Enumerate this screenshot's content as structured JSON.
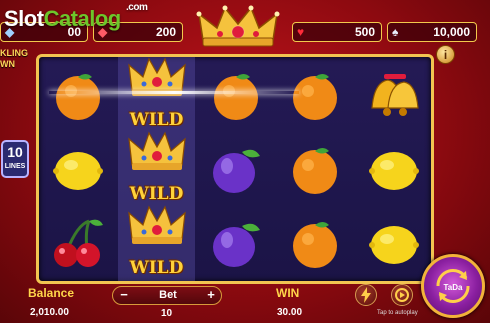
{
  "watermark": {
    "part1": "Slot",
    "part2": "Catalog",
    "part3": ".com"
  },
  "top": {
    "chip_a_value": "00",
    "chip_b_value": "200",
    "chip_c_value": "500",
    "chip_d_value": "10,000",
    "title_fragment_line1": "KLING",
    "title_fragment_line2": "WN",
    "info_label": "i"
  },
  "lines": {
    "count": "10",
    "label": "LINES"
  },
  "reels": [
    [
      "orange",
      "lemon",
      "cherry"
    ],
    [
      "wild",
      "wild",
      "wild"
    ],
    [
      "orange",
      "plum",
      "plum"
    ],
    [
      "orange",
      "orange",
      "orange"
    ],
    [
      "bell",
      "lemon",
      "lemon"
    ]
  ],
  "wild_text": "WILD",
  "bottom": {
    "balance_label": "Balance",
    "balance_value": "2,010.00",
    "bet_label": "Bet",
    "bet_value": "10",
    "bet_minus": "−",
    "bet_plus": "+",
    "win_label": "WIN",
    "win_value": "30.00",
    "spin_label": "TaDa",
    "tap_hint": "Tap to autoplay"
  },
  "colors": {
    "accent_gold": "#f2c451",
    "label_yellow": "#ffd64a",
    "spin_purple": "#8a1fa0",
    "background_red": "#c2141c"
  }
}
